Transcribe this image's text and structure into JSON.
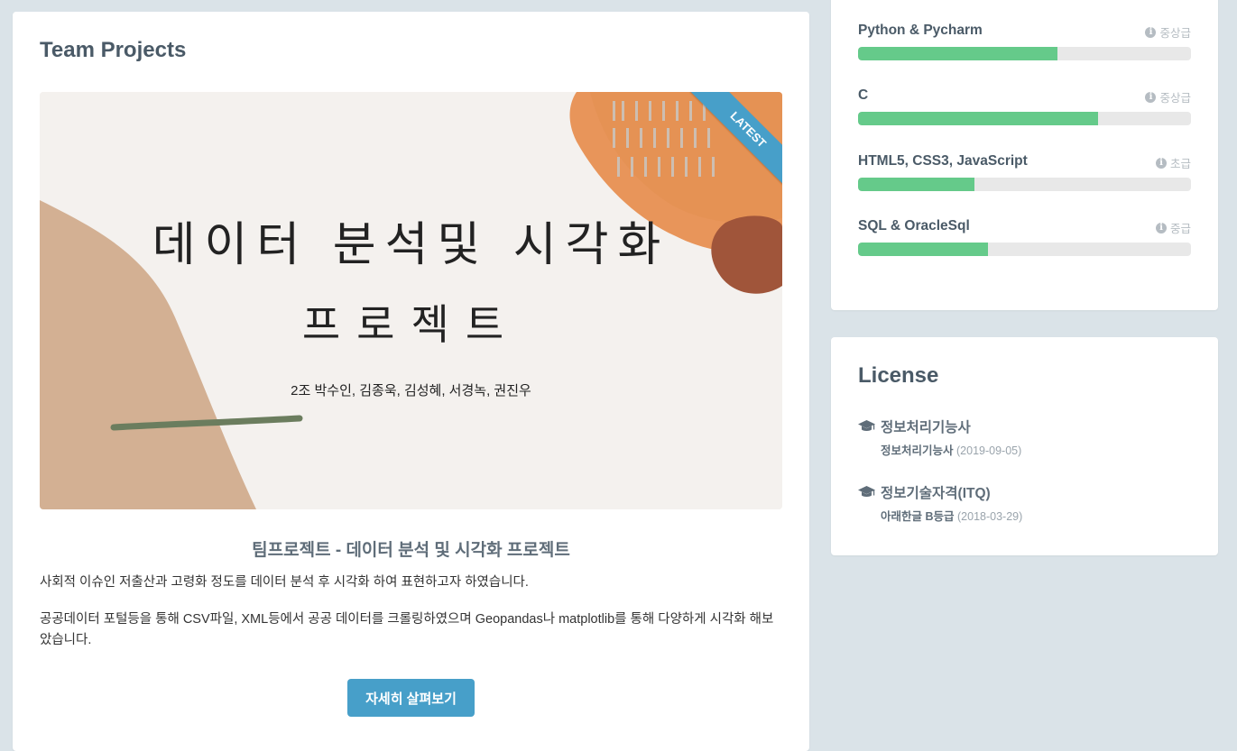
{
  "projects": {
    "title": "Team Projects",
    "ribbon": "LATEST",
    "slide": {
      "title_line1": "데이터 분석및 시각화",
      "title_line2": "프로젝트",
      "members": "2조 박수인, 김종욱, 김성혜, 서경녹, 권진우"
    },
    "project_title": "팀프로젝트 - 데이터 분석 및 시각화 프로젝트",
    "description_1": "사회적 이슈인 저출산과 고령화 정도를 데이터 분석 후 시각화 하여 표현하고자 하였습니다.",
    "description_2": "공공데이터 포털등을 통해 CSV파일, XML등에서 공공 데이터를 크롤링하였으며 Geopandas나 matplotlib를 통해 다양하게 시각화 해보았습니다.",
    "button_label": "자세히 살펴보기"
  },
  "skills": [
    {
      "name": "Python & Pycharm",
      "level": "중상급",
      "percent": 60
    },
    {
      "name": "C",
      "level": "중상급",
      "percent": 72
    },
    {
      "name": "HTML5, CSS3, JavaScript",
      "level": "초급",
      "percent": 35
    },
    {
      "name": "SQL & OracleSql",
      "level": "중급",
      "percent": 39
    }
  ],
  "license": {
    "title": "License",
    "items": [
      {
        "name": "정보처리기능사",
        "detail": "정보처리기능사",
        "date": "(2019-09-05)"
      },
      {
        "name": "정보기술자격(ITQ)",
        "detail": "아래한글 B등급",
        "date": "(2018-03-29)"
      }
    ]
  },
  "colors": {
    "accent": "#479fc9",
    "bar_fill": "#65ca8a",
    "bar_track": "#e8e8e8",
    "background": "#dae3e8"
  }
}
